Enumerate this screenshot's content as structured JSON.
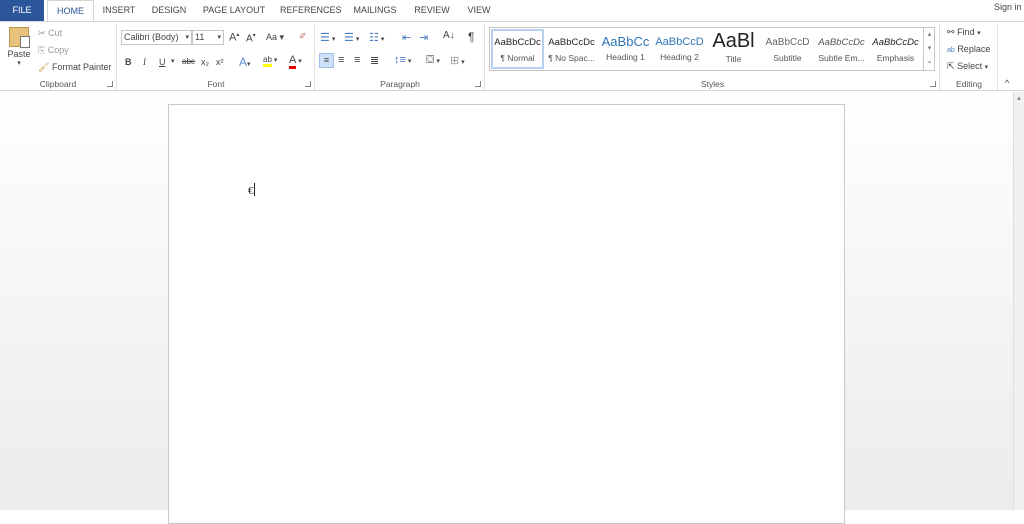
{
  "tabs": [
    "FILE",
    "HOME",
    "INSERT",
    "DESIGN",
    "PAGE LAYOUT",
    "REFERENCES",
    "MAILINGS",
    "REVIEW",
    "VIEW"
  ],
  "active_tab": "HOME",
  "sign_in": "Sign in",
  "clipboard": {
    "label": "Clipboard",
    "paste": "Paste",
    "cut": "Cut",
    "copy": "Copy",
    "format_painter": "Format Painter"
  },
  "font": {
    "label": "Font",
    "family": "Calibri (Body)",
    "size": "11",
    "change_case": "Aa",
    "bold": "B",
    "italic": "I",
    "underline": "U",
    "strike": "abc",
    "subscript": "x₂",
    "superscript": "x²",
    "highlight_color": "#ffff00",
    "font_color": "#e00000"
  },
  "paragraph": {
    "label": "Paragraph",
    "pilcrow": "¶"
  },
  "styles": {
    "label": "Styles",
    "items": [
      {
        "preview": "AaBbCcDc",
        "name": "¶ Normal"
      },
      {
        "preview": "AaBbCcDc",
        "name": "¶ No Spac..."
      },
      {
        "preview": "AaBbCc",
        "name": "Heading 1"
      },
      {
        "preview": "AaBbCcD",
        "name": "Heading 2"
      },
      {
        "preview": "AaBl",
        "name": "Title"
      },
      {
        "preview": "AaBbCcD",
        "name": "Subtitle"
      },
      {
        "preview": "AaBbCcDc",
        "name": "Subtle Em..."
      },
      {
        "preview": "AaBbCcDc",
        "name": "Emphasis"
      }
    ]
  },
  "editing": {
    "label": "Editing",
    "find": "Find",
    "replace": "Replace",
    "select": "Select"
  },
  "document": {
    "text": "€"
  },
  "colors": {
    "accent": "#2b579a"
  }
}
